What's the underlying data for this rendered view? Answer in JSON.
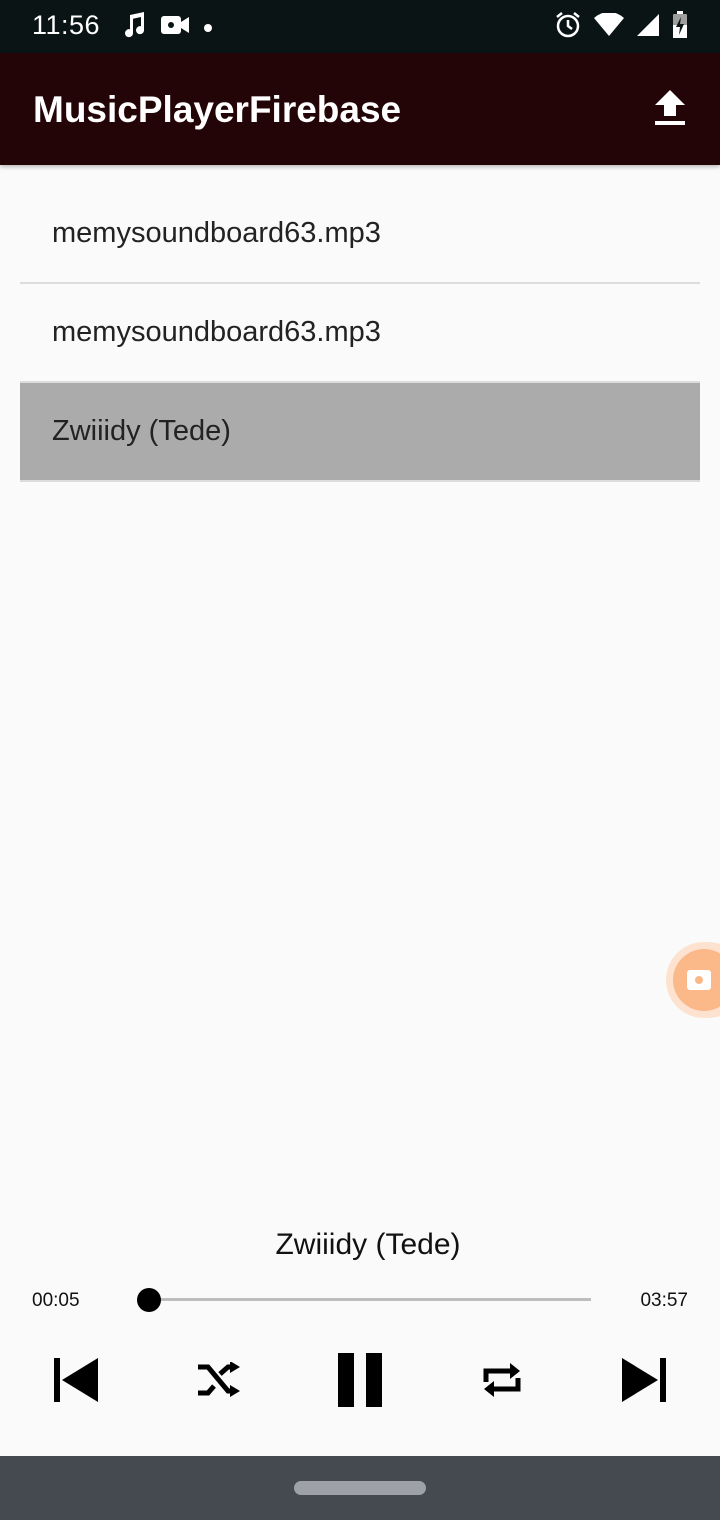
{
  "status_bar": {
    "time": "11:56",
    "icons_left": [
      "music-note-icon",
      "video-camera-icon",
      "notification-dot-icon"
    ],
    "icons_right": [
      "alarm-icon",
      "wifi-icon",
      "signal-icon",
      "battery-charging-icon"
    ]
  },
  "app_bar": {
    "title": "MusicPlayerFirebase",
    "upload_icon": "upload-icon",
    "background_color": "#230407"
  },
  "songs": [
    {
      "name": "memysoundboard63.mp3",
      "selected": false
    },
    {
      "name": "memysoundboard63.mp3",
      "selected": false
    },
    {
      "name": "Zwiiidy (Tede)",
      "selected": true
    }
  ],
  "player": {
    "now_playing": "Zwiiidy (Tede)",
    "elapsed": "00:05",
    "duration": "03:57",
    "progress_fraction": 0.021,
    "controls": [
      "previous-icon",
      "shuffle-icon",
      "pause-icon",
      "repeat-icon",
      "next-icon"
    ]
  },
  "colors": {
    "selected_row": "#ababab",
    "status_bar": "#0b1414",
    "nav_bar": "#444a4f",
    "floating_bubble": "#fbb889"
  }
}
